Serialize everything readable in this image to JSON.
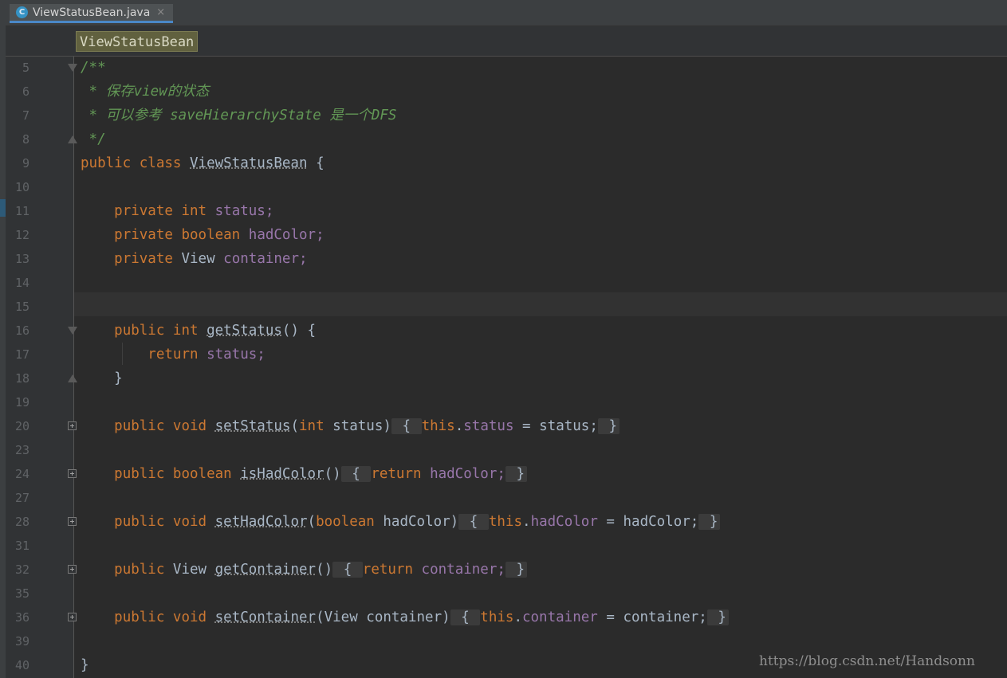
{
  "tab": {
    "label": "ViewStatusBean.java",
    "icon": "C",
    "close": "×"
  },
  "breadcrumb": {
    "label": "ViewStatusBean"
  },
  "line_numbers": [
    "5",
    "6",
    "7",
    "8",
    "9",
    "10",
    "11",
    "12",
    "13",
    "14",
    "15",
    "16",
    "17",
    "18",
    "19",
    "20",
    "23",
    "24",
    "27",
    "28",
    "31",
    "32",
    "35",
    "36",
    "39",
    "40"
  ],
  "code": {
    "c5": "/**",
    "c6": " * 保存view的状态",
    "c7": " * 可以参考 saveHierarchyState 是一个DFS",
    "c8": " */",
    "l9": [
      "public",
      "class",
      "ViewStatusBean",
      "{"
    ],
    "l11": [
      "private",
      "int",
      "status;"
    ],
    "l12": [
      "private",
      "boolean",
      "hadColor;"
    ],
    "l13": [
      "private",
      "View",
      "container;"
    ],
    "l16": [
      "public",
      "int",
      "getStatus",
      "()",
      "{"
    ],
    "l17": [
      "return",
      "status;"
    ],
    "l18": "}",
    "l20": [
      "public",
      "void",
      "setStatus",
      "(",
      "int",
      "status)",
      "{",
      "this",
      ".",
      "status",
      "=",
      "status;",
      "}"
    ],
    "l24": [
      "public",
      "boolean",
      "isHadColor",
      "()",
      "{",
      "return",
      "hadColor;",
      "}"
    ],
    "l28": [
      "public",
      "void",
      "setHadColor",
      "(",
      "boolean",
      "hadColor)",
      "{",
      "this",
      ".",
      "hadColor",
      "=",
      "hadColor;",
      "}"
    ],
    "l32": [
      "public",
      "View",
      "getContainer",
      "()",
      "{",
      "return",
      "container;",
      "}"
    ],
    "l36": [
      "public",
      "void",
      "setContainer",
      "(View container)",
      "{",
      "this",
      ".",
      "container",
      "=",
      "container;",
      "}"
    ],
    "l40": "}"
  },
  "watermark": "https://blog.csdn.net/Handsonn",
  "colors": {
    "keyword": "#cc7832",
    "field": "#9876aa",
    "comment": "#629755",
    "text": "#a9b7c6",
    "background": "#2b2b2b"
  },
  "icons": {
    "fold_collapsed": "plus-box",
    "fold_expanded": "minus-box"
  }
}
